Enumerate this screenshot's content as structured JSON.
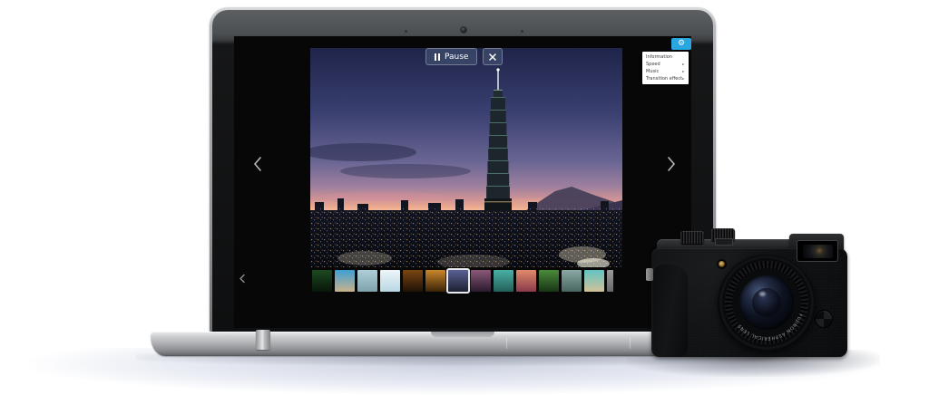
{
  "slideshow": {
    "pause_button": {
      "label": "Pause"
    },
    "settings_menu": {
      "items": [
        {
          "label": "Information",
          "has_submenu": false
        },
        {
          "label": "Speed",
          "has_submenu": true
        },
        {
          "label": "Music",
          "has_submenu": true
        },
        {
          "label": "Transition effect",
          "has_submenu": true
        }
      ]
    },
    "current_slide": {
      "description": "Taipei 101 city skyline at dusk"
    },
    "thumbnails": {
      "selected_index": 6,
      "items": [
        {
          "desc": "dark foliage",
          "c1": "#1d4a20",
          "c2": "#08160a"
        },
        {
          "desc": "beach with boat",
          "c1": "#3f9fd4",
          "c2": "#c9b28b"
        },
        {
          "desc": "fish closeup",
          "c1": "#aecfd8",
          "c2": "#7fa2ad"
        },
        {
          "desc": "bright beach sky",
          "c1": "#eef6f9",
          "c2": "#b8d7e3"
        },
        {
          "desc": "palm sunset",
          "c1": "#7a4512",
          "c2": "#1f1206"
        },
        {
          "desc": "amber glow",
          "c1": "#c9882a",
          "c2": "#3a2208"
        },
        {
          "desc": "taipei skyline",
          "c1": "#5a6094",
          "c2": "#1c2030"
        },
        {
          "desc": "purple dusk",
          "c1": "#8a5878",
          "c2": "#2a1a2e"
        },
        {
          "desc": "teal beach figure",
          "c1": "#4ab0a4",
          "c2": "#23605a"
        },
        {
          "desc": "pink city",
          "c1": "#e08a6a",
          "c2": "#8a3a4a"
        },
        {
          "desc": "green palms",
          "c1": "#4a8a3a",
          "c2": "#183416"
        },
        {
          "desc": "teal rocks",
          "c1": "#8aa9a4",
          "c2": "#48655f"
        },
        {
          "desc": "sand beach",
          "c1": "#62c4c4",
          "c2": "#d2c298"
        },
        {
          "desc": "gray partial",
          "c1": "#9a9b9c",
          "c2": "#66686a"
        }
      ]
    }
  },
  "glyphs": {
    "gear": "⚙",
    "submenu_arrow": "▸"
  },
  "colors": {
    "accent_blue": "#2aa7e0",
    "overlay_button_bg": "rgba(58,72,105,0.88)",
    "menu_bg": "#ffffff",
    "menu_text": "#3c3c3c",
    "screen_bg": "#070708",
    "selected_thumb_border": "#e9eaee",
    "sky_top": "#1f244a",
    "sky_horizon": "#f6c09c",
    "city_silhouette": "#0d0f17"
  }
}
